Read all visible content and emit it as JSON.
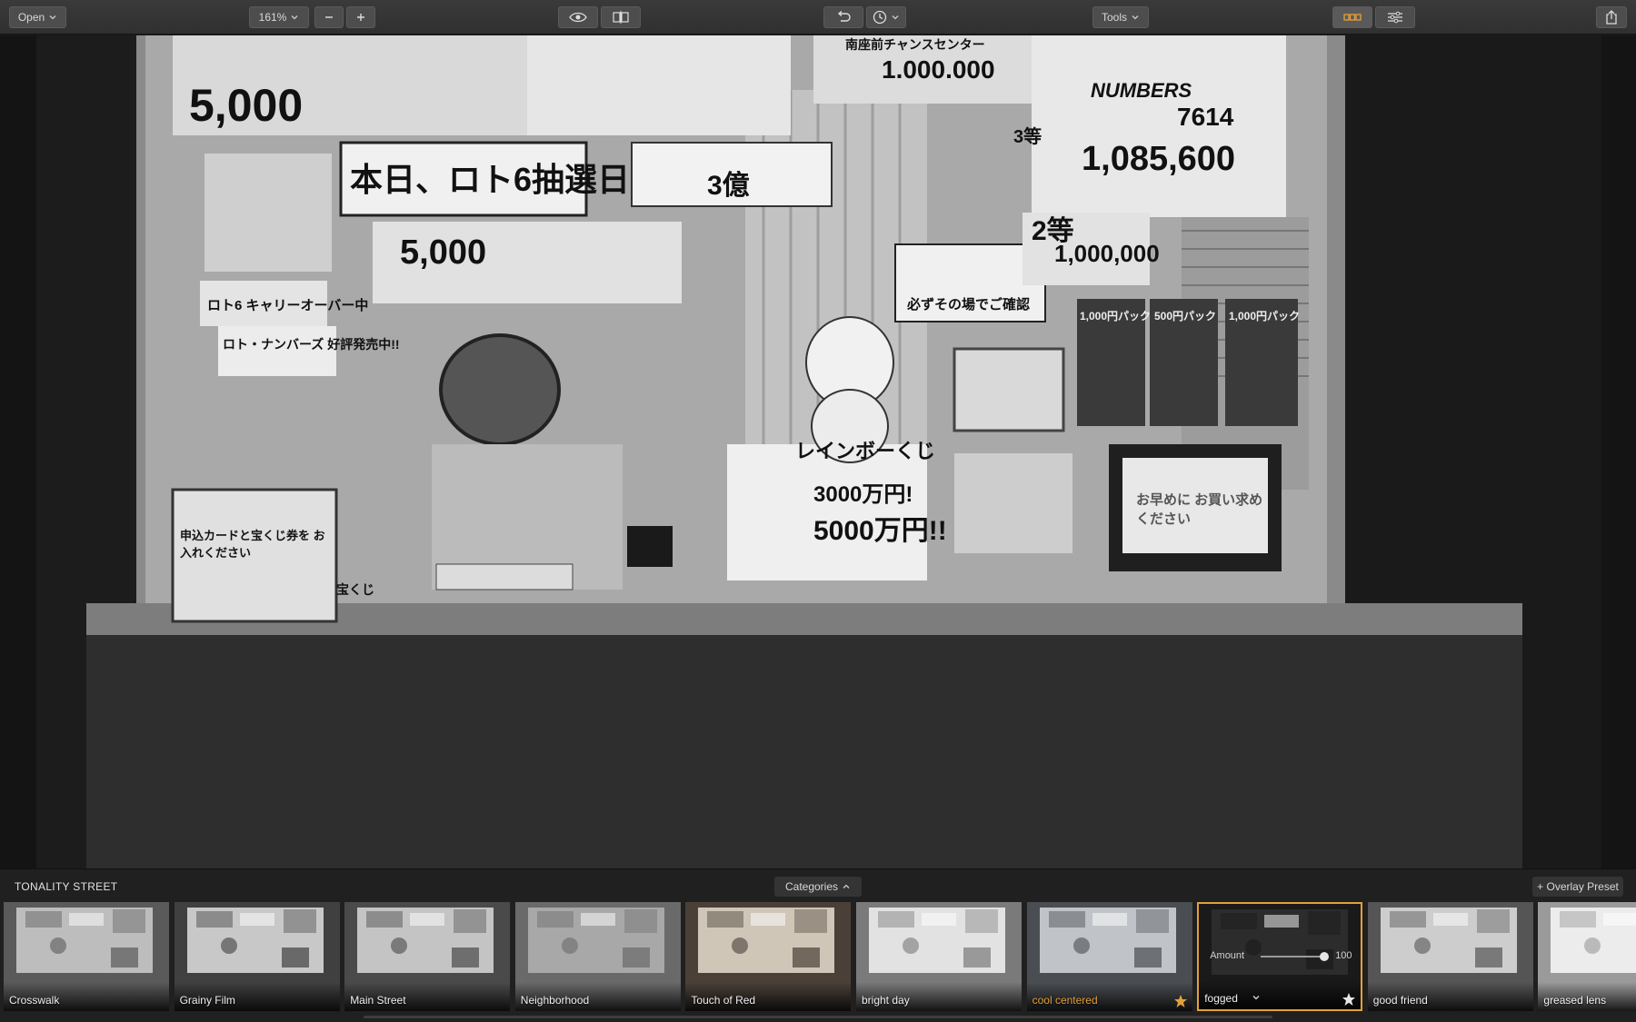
{
  "toolbar": {
    "open_label": "Open",
    "zoom_value": "161%",
    "tools_label": "Tools"
  },
  "panel": {
    "title": "TONALITY STREET",
    "categories_label": "Categories",
    "overlay_label": "+ Overlay Preset"
  },
  "presets": [
    {
      "label": "Crosswalk"
    },
    {
      "label": "Grainy Film"
    },
    {
      "label": "Main Street"
    },
    {
      "label": "Neighborhood"
    },
    {
      "label": "Touch of Red"
    },
    {
      "label": "bright day"
    },
    {
      "label": "cool centered",
      "favorite": true
    },
    {
      "label": "fogged",
      "favorite": true,
      "selected": true,
      "amount_label": "Amount",
      "amount_value": "100"
    },
    {
      "label": "good friend"
    },
    {
      "label": "greased lens"
    }
  ],
  "photo_signs": {
    "s1": "5,000",
    "s2": "本日、ロト6抽選日",
    "s3": "5,000",
    "s4": "3億",
    "s5": "1.000.000",
    "s6": "NUMBERS",
    "s7": "7614",
    "s8": "1,085,600",
    "s9": "2等",
    "s10": "1,000,000",
    "s11": "必ずその場でご確認",
    "s12": "ロト6 キャリーオーバー中",
    "s13": "ロト・ナンバーズ 好評発売中!!",
    "s14": "レインボーくじ",
    "s15": "3000万円!",
    "s16": "5000万円!!",
    "s17": "申込カードと宝くじ券を お入れください",
    "s18": "1,000円パック",
    "s19": "500円パック",
    "s20": "1,000円パック",
    "s21": "お早めに お買い求めください",
    "s22": "南座前チャンスセンター",
    "s23": "宝くじ",
    "s24": "3等"
  },
  "colors": {
    "accent": "#e3a03c",
    "favorite_star": "#e3a03c",
    "toolbar_bg": "#363636",
    "panel_bg": "#202020"
  }
}
